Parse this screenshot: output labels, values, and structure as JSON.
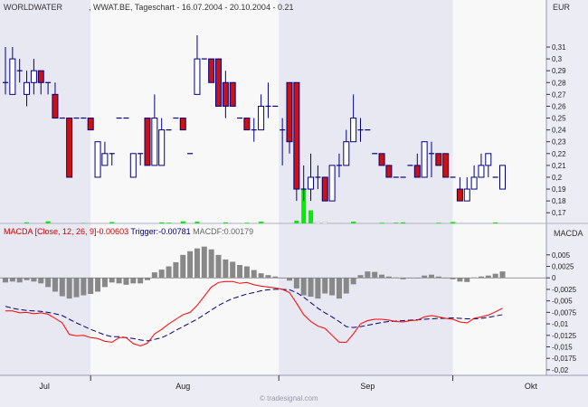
{
  "header": {
    "symbol": "WORLDWATER",
    "info": ", WWAT.BE, Tageschart - 16.07.2004 - 20.10.2004 - 0.21",
    "currency": "EUR"
  },
  "macd_legend": {
    "macd": "MACDA [Close, 12, 26, 9]-0.00603",
    "trigger": "Trigger:-0.00781",
    "macdf": "MACDF:0.00179"
  },
  "macd_axis_title": "MACDA",
  "credit": "© tradesignal.com",
  "colors": {
    "up_body": "#ffffff",
    "down_body": "#cc1111",
    "candle_outline": "#000080",
    "volume_up": "#00ee00",
    "volume_down": "#ffffff",
    "histogram": "#888888",
    "macd_line": "#ff0000",
    "trigger_line": "#000080",
    "band_shade": "#e8e8f2",
    "band_plain": "#f8f8f8"
  },
  "chart_data": [
    {
      "type": "candlestick",
      "yticks": [
        0.17,
        0.18,
        0.19,
        0.2,
        0.21,
        0.22,
        0.23,
        0.24,
        0.25,
        0.26,
        0.27,
        0.28,
        0.29,
        0.3,
        0.31
      ],
      "ytick_labels": [
        "0,17",
        "0,18",
        "0,19",
        "0,2",
        "0,21",
        "0,22",
        "0,23",
        "0,24",
        "0,25",
        "0,26",
        "0,27",
        "0,28",
        "0,29",
        "0,3",
        "0,31"
      ],
      "ylim": [
        0.161,
        0.336
      ],
      "month_labels": [
        {
          "label": "Jul",
          "index": 5.5
        },
        {
          "label": "Aug",
          "index": 25
        },
        {
          "label": "Sep",
          "index": 51
        },
        {
          "label": "Okt",
          "index": 74
        }
      ],
      "month_boundaries": [
        12,
        38.5,
        63
      ],
      "candles": [
        {
          "o": 0.28,
          "h": 0.31,
          "l": 0.27,
          "c": 0.28
        },
        {
          "o": 0.27,
          "h": 0.31,
          "l": 0.27,
          "c": 0.3
        },
        {
          "o": 0.29,
          "h": 0.3,
          "l": 0.28,
          "c": 0.29
        },
        {
          "o": 0.27,
          "h": 0.29,
          "l": 0.26,
          "c": 0.28
        },
        {
          "o": 0.28,
          "h": 0.3,
          "l": 0.27,
          "c": 0.29
        },
        {
          "o": 0.29,
          "h": 0.29,
          "l": 0.27,
          "c": 0.28
        },
        {
          "o": 0.28,
          "h": 0.28,
          "l": 0.27,
          "c": 0.28
        },
        {
          "o": 0.27,
          "h": 0.28,
          "l": 0.25,
          "c": 0.25
        },
        {
          "o": 0.25,
          "h": 0.25,
          "l": 0.25,
          "c": 0.25
        },
        {
          "o": 0.25,
          "h": 0.25,
          "l": 0.2,
          "c": 0.2
        },
        {
          "o": 0.25,
          "h": 0.25,
          "l": 0.25,
          "c": 0.25
        },
        {
          "o": 0.25,
          "h": 0.25,
          "l": 0.25,
          "c": 0.25
        },
        {
          "o": 0.25,
          "h": 0.25,
          "l": 0.24,
          "c": 0.24
        },
        {
          "o": 0.2,
          "h": 0.23,
          "l": 0.2,
          "c": 0.23
        },
        {
          "o": 0.21,
          "h": 0.23,
          "l": 0.21,
          "c": 0.22
        },
        {
          "o": 0.22,
          "h": 0.22,
          "l": 0.21,
          "c": 0.22
        },
        {
          "o": 0.25,
          "h": 0.25,
          "l": 0.25,
          "c": 0.25
        },
        {
          "o": 0.25,
          "h": 0.25,
          "l": 0.25,
          "c": 0.25
        },
        {
          "o": 0.2,
          "h": 0.22,
          "l": 0.2,
          "c": 0.22
        },
        {
          "o": 0.22,
          "h": 0.22,
          "l": 0.21,
          "c": 0.22
        },
        {
          "o": 0.25,
          "h": 0.25,
          "l": 0.21,
          "c": 0.21
        },
        {
          "o": 0.21,
          "h": 0.27,
          "l": 0.21,
          "c": 0.25
        },
        {
          "o": 0.21,
          "h": 0.25,
          "l": 0.21,
          "c": 0.24
        },
        {
          "o": 0.24,
          "h": 0.24,
          "l": 0.24,
          "c": 0.24
        },
        {
          "o": 0.25,
          "h": 0.25,
          "l": 0.25,
          "c": 0.25
        },
        {
          "o": 0.25,
          "h": 0.25,
          "l": 0.24,
          "c": 0.24
        },
        {
          "o": 0.22,
          "h": 0.22,
          "l": 0.22,
          "c": 0.22
        },
        {
          "o": 0.27,
          "h": 0.32,
          "l": 0.27,
          "c": 0.3
        },
        {
          "o": 0.3,
          "h": 0.3,
          "l": 0.3,
          "c": 0.3
        },
        {
          "o": 0.3,
          "h": 0.3,
          "l": 0.28,
          "c": 0.28
        },
        {
          "o": 0.3,
          "h": 0.3,
          "l": 0.26,
          "c": 0.26
        },
        {
          "o": 0.28,
          "h": 0.29,
          "l": 0.25,
          "c": 0.26
        },
        {
          "o": 0.28,
          "h": 0.28,
          "l": 0.26,
          "c": 0.26
        },
        {
          "o": 0.25,
          "h": 0.25,
          "l": 0.25,
          "c": 0.25
        },
        {
          "o": 0.25,
          "h": 0.25,
          "l": 0.24,
          "c": 0.24
        },
        {
          "o": 0.24,
          "h": 0.25,
          "l": 0.23,
          "c": 0.24
        },
        {
          "o": 0.24,
          "h": 0.27,
          "l": 0.24,
          "c": 0.26
        },
        {
          "o": 0.26,
          "h": 0.28,
          "l": 0.25,
          "c": 0.26
        },
        {
          "o": 0.26,
          "h": 0.26,
          "l": 0.26,
          "c": 0.26
        },
        {
          "o": 0.24,
          "h": 0.25,
          "l": 0.21,
          "c": 0.24
        },
        {
          "o": 0.28,
          "h": 0.28,
          "l": 0.22,
          "c": 0.23
        },
        {
          "o": 0.28,
          "h": 0.28,
          "l": 0.18,
          "c": 0.19
        },
        {
          "o": 0.19,
          "h": 0.21,
          "l": 0.18,
          "c": 0.19
        },
        {
          "o": 0.19,
          "h": 0.22,
          "l": 0.18,
          "c": 0.2
        },
        {
          "o": 0.2,
          "h": 0.21,
          "l": 0.19,
          "c": 0.2
        },
        {
          "o": 0.2,
          "h": 0.2,
          "l": 0.18,
          "c": 0.18
        },
        {
          "o": 0.18,
          "h": 0.21,
          "l": 0.18,
          "c": 0.21
        },
        {
          "o": 0.21,
          "h": 0.22,
          "l": 0.2,
          "c": 0.21
        },
        {
          "o": 0.21,
          "h": 0.24,
          "l": 0.21,
          "c": 0.23
        },
        {
          "o": 0.23,
          "h": 0.27,
          "l": 0.23,
          "c": 0.25
        },
        {
          "o": 0.24,
          "h": 0.25,
          "l": 0.23,
          "c": 0.24
        },
        {
          "o": 0.24,
          "h": 0.24,
          "l": 0.24,
          "c": 0.24
        },
        {
          "o": 0.22,
          "h": 0.22,
          "l": 0.22,
          "c": 0.22
        },
        {
          "o": 0.22,
          "h": 0.22,
          "l": 0.21,
          "c": 0.21
        },
        {
          "o": 0.21,
          "h": 0.21,
          "l": 0.2,
          "c": 0.2
        },
        {
          "o": 0.2,
          "h": 0.2,
          "l": 0.2,
          "c": 0.2
        },
        {
          "o": 0.2,
          "h": 0.2,
          "l": 0.2,
          "c": 0.2
        },
        {
          "o": 0.21,
          "h": 0.21,
          "l": 0.21,
          "c": 0.21
        },
        {
          "o": 0.21,
          "h": 0.22,
          "l": 0.2,
          "c": 0.2
        },
        {
          "o": 0.2,
          "h": 0.23,
          "l": 0.2,
          "c": 0.23
        },
        {
          "o": 0.22,
          "h": 0.23,
          "l": 0.2,
          "c": 0.22
        },
        {
          "o": 0.22,
          "h": 0.22,
          "l": 0.21,
          "c": 0.21
        },
        {
          "o": 0.22,
          "h": 0.22,
          "l": 0.2,
          "c": 0.2
        },
        {
          "o": 0.2,
          "h": 0.2,
          "l": 0.2,
          "c": 0.2
        },
        {
          "o": 0.19,
          "h": 0.2,
          "l": 0.18,
          "c": 0.18
        },
        {
          "o": 0.18,
          "h": 0.2,
          "l": 0.18,
          "c": 0.19
        },
        {
          "o": 0.19,
          "h": 0.21,
          "l": 0.19,
          "c": 0.2
        },
        {
          "o": 0.2,
          "h": 0.22,
          "l": 0.2,
          "c": 0.21
        },
        {
          "o": 0.21,
          "h": 0.22,
          "l": 0.2,
          "c": 0.22
        },
        {
          "o": 0.2,
          "h": 0.2,
          "l": 0.2,
          "c": 0.2
        },
        {
          "o": 0.19,
          "h": 0.21,
          "l": 0.19,
          "c": 0.21
        }
      ],
      "volume_scale": [
        0,
        100
      ],
      "volumes": [
        0,
        0,
        0,
        3,
        0,
        0,
        6,
        0,
        0,
        0,
        0,
        1,
        0,
        0,
        0,
        4,
        0,
        0,
        0,
        0,
        0,
        0,
        3,
        2,
        0,
        6,
        0,
        5,
        0,
        0,
        0,
        3,
        0,
        0,
        2,
        0,
        5,
        0,
        0,
        0,
        0,
        8,
        100,
        38,
        4,
        4,
        2,
        2,
        0,
        5,
        0,
        0,
        0,
        2,
        0,
        2,
        3,
        0,
        0,
        0,
        0,
        2,
        0,
        4,
        0,
        0,
        0,
        0,
        0,
        3,
        0
      ],
      "volume_up": [
        false,
        false,
        false,
        true,
        false,
        false,
        true,
        false,
        false,
        false,
        false,
        true,
        false,
        false,
        false,
        true,
        false,
        false,
        false,
        false,
        false,
        false,
        true,
        true,
        false,
        true,
        false,
        true,
        false,
        false,
        false,
        true,
        false,
        false,
        true,
        false,
        true,
        false,
        false,
        false,
        false,
        true,
        true,
        true,
        false,
        false,
        false,
        false,
        false,
        true,
        false,
        false,
        false,
        true,
        false,
        true,
        true,
        false,
        false,
        false,
        false,
        true,
        false,
        true,
        false,
        false,
        false,
        false,
        false,
        true,
        false
      ]
    },
    {
      "type": "macd",
      "yticks": [
        0.005,
        0.0025,
        0,
        -0.0025,
        -0.005,
        -0.0075,
        -0.01,
        -0.0125,
        -0.015,
        -0.0175,
        -0.02
      ],
      "ytick_labels": [
        "0,005",
        "0,0025",
        "0",
        "-0,0025",
        "-0,005",
        "-0,0075",
        "-0,01",
        "-0,0125",
        "-0,015",
        "-0,0175",
        "-0,02"
      ],
      "ylim": [
        -0.0212,
        0.0087
      ],
      "macd": [
        -0.0072,
        -0.0072,
        -0.0076,
        -0.0075,
        -0.0078,
        -0.0076,
        -0.0079,
        -0.0088,
        -0.0098,
        -0.0123,
        -0.0126,
        -0.0125,
        -0.013,
        -0.0132,
        -0.0138,
        -0.014,
        -0.013,
        -0.013,
        -0.0143,
        -0.0148,
        -0.0142,
        -0.0122,
        -0.0112,
        -0.01,
        -0.009,
        -0.008,
        -0.0075,
        -0.006,
        -0.004,
        -0.002,
        -0.001,
        -0.0008,
        -0.0008,
        -0.0012,
        -0.001,
        -0.0015,
        -0.0018,
        -0.002,
        -0.0022,
        -0.0025,
        -0.0032,
        -0.0055,
        -0.008,
        -0.0095,
        -0.0105,
        -0.011,
        -0.0125,
        -0.014,
        -0.014,
        -0.0122,
        -0.01,
        -0.0093,
        -0.009,
        -0.009,
        -0.0092,
        -0.0095,
        -0.0096,
        -0.0093,
        -0.0092,
        -0.0085,
        -0.0082,
        -0.0085,
        -0.0088,
        -0.009,
        -0.0096,
        -0.0098,
        -0.0088,
        -0.0085,
        -0.0081,
        -0.0074,
        -0.0066
      ],
      "trigger": [
        -0.0062,
        -0.0066,
        -0.0069,
        -0.0071,
        -0.0072,
        -0.0073,
        -0.0075,
        -0.0078,
        -0.0082,
        -0.009,
        -0.0098,
        -0.0105,
        -0.0112,
        -0.0118,
        -0.0124,
        -0.0128,
        -0.0128,
        -0.013,
        -0.0132,
        -0.0135,
        -0.0137,
        -0.0134,
        -0.013,
        -0.0123,
        -0.0114,
        -0.0106,
        -0.0098,
        -0.009,
        -0.008,
        -0.007,
        -0.006,
        -0.0052,
        -0.0045,
        -0.004,
        -0.0035,
        -0.0032,
        -0.0028,
        -0.0026,
        -0.0025,
        -0.0025,
        -0.0026,
        -0.0032,
        -0.0042,
        -0.0054,
        -0.0066,
        -0.0076,
        -0.0085,
        -0.0095,
        -0.0106,
        -0.0108,
        -0.0106,
        -0.0103,
        -0.01,
        -0.0097,
        -0.0095,
        -0.0094,
        -0.0093,
        -0.0092,
        -0.0091,
        -0.009,
        -0.0089,
        -0.0088,
        -0.0088,
        -0.0087,
        -0.0088,
        -0.0089,
        -0.0089,
        -0.0088,
        -0.0086,
        -0.0083,
        -0.008
      ],
      "histogram": [
        -0.001,
        -0.0008,
        -0.001,
        -0.0005,
        -0.0008,
        -0.0012,
        -0.002,
        -0.003,
        -0.004,
        -0.0045,
        -0.0042,
        -0.0038,
        -0.0035,
        -0.003,
        -0.002,
        -0.001,
        -0.0012,
        -0.0015,
        -0.0012,
        -0.0012,
        -0.0005,
        0.0012,
        0.0018,
        0.0025,
        0.0034,
        0.005,
        0.0058,
        0.0064,
        0.0068,
        0.0062,
        0.005,
        0.004,
        0.0035,
        0.0028,
        0.0025,
        0.0017,
        0.001,
        0.0006,
        0.0003,
        0.0,
        -0.0006,
        -0.0023,
        -0.0038,
        -0.0041,
        -0.0045,
        -0.0034,
        -0.0038,
        -0.0045,
        -0.0034,
        -0.0014,
        0.0006,
        0.0014,
        0.0013,
        0.0007,
        0.0003,
        0.0001,
        -0.0003,
        -0.0001,
        -0.0001,
        0.0005,
        0.0007,
        0.0003,
        -0.0001,
        -0.0003,
        -0.0008,
        -0.0009,
        0.0001,
        0.0003,
        0.0005,
        0.0009,
        0.0014
      ]
    }
  ]
}
